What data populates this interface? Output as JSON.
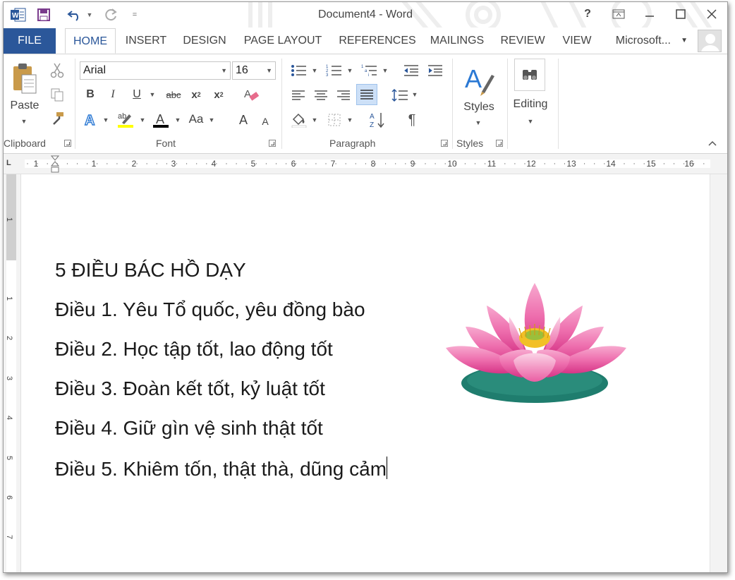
{
  "window": {
    "title": "Document4 - Word"
  },
  "tabs": [
    "FILE",
    "HOME",
    "INSERT",
    "DESIGN",
    "PAGE LAYOUT",
    "REFERENCES",
    "MAILINGS",
    "REVIEW",
    "VIEW"
  ],
  "account": {
    "name": "Microsoft..."
  },
  "ribbon": {
    "clipboard": {
      "label": "Clipboard",
      "paste": "Paste"
    },
    "font": {
      "label": "Font",
      "name": "Arial",
      "size": "16",
      "grow": "A",
      "shrink": "A",
      "case": "Aa"
    },
    "paragraph": {
      "label": "Paragraph"
    },
    "styles": {
      "label": "Styles",
      "button": "Styles"
    },
    "editing": {
      "button": "Editing"
    }
  },
  "ruler": {
    "numbers": [
      "1",
      "1",
      "2",
      "3",
      "4",
      "5",
      "6",
      "7",
      "8",
      "9",
      "10",
      "11",
      "12",
      "13",
      "14",
      "15",
      "16"
    ]
  },
  "vruler": {
    "numbers": [
      "1",
      "1",
      "2",
      "3",
      "4",
      "5",
      "6",
      "7"
    ]
  },
  "document": {
    "lines": [
      "5 ĐIỀU BÁC HỒ DẠY",
      "Điều 1. Yêu Tổ quốc, yêu đồng bào",
      "Điều 2. Học tập tốt, lao động tốt",
      "Điều 3. Đoàn kết tốt, kỷ luật tốt",
      "Điều 4. Giữ gìn vệ sinh thật tốt",
      "Điều 5. Khiêm tốn, thật thà, dũng cảm"
    ]
  },
  "colors": {
    "accent": "#2b579a",
    "lotus_petal": "#e94d9a",
    "lotus_leaf": "#1a7a6a",
    "lotus_center": "#f2c026"
  }
}
